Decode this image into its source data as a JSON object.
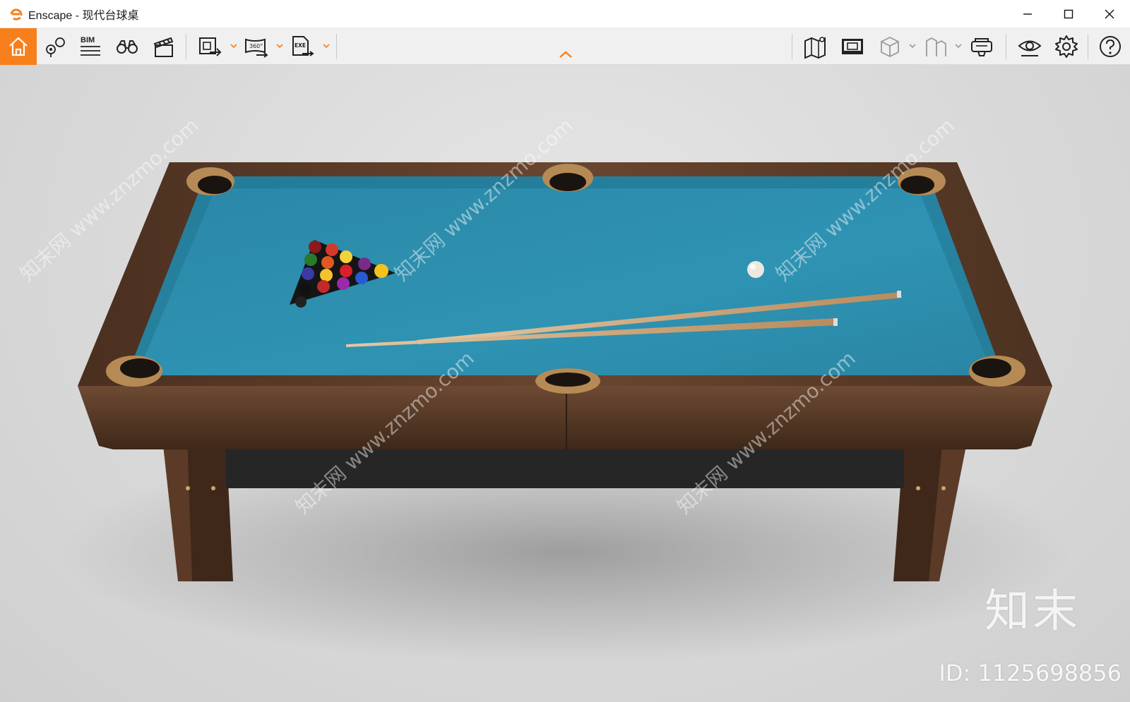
{
  "window": {
    "title": "Enscape - 现代台球桌",
    "controls": [
      "minimize-icon",
      "maximize-icon",
      "close-icon"
    ]
  },
  "toolbar": {
    "accent": "#f77f1c",
    "left_tools": [
      {
        "name": "home-icon"
      },
      {
        "name": "views-icon"
      },
      {
        "name": "bim-icon",
        "label": "BIM"
      },
      {
        "name": "binoculars-icon"
      },
      {
        "name": "clapper-icon"
      },
      {
        "name": "render-export-icon"
      },
      {
        "name": "panorama-export-icon",
        "label": "360°"
      },
      {
        "name": "exe-export-icon",
        "label": "EXE"
      }
    ],
    "right_tools": [
      {
        "name": "map-icon"
      },
      {
        "name": "monitor-icon"
      },
      {
        "name": "cube-icon"
      },
      {
        "name": "building-icon"
      },
      {
        "name": "vr-headset-icon"
      },
      {
        "name": "eye-icon"
      },
      {
        "name": "settings-icon"
      },
      {
        "name": "help-icon"
      }
    ]
  },
  "viewport": {
    "scene": "billiard-table-render",
    "cloth_color": "#2f93b3",
    "wood_color": "#5a3b28"
  },
  "watermark": {
    "brand": "知末",
    "id": "ID: 1125698856",
    "diagonal_text": "知末网 www.znzmo.com"
  }
}
